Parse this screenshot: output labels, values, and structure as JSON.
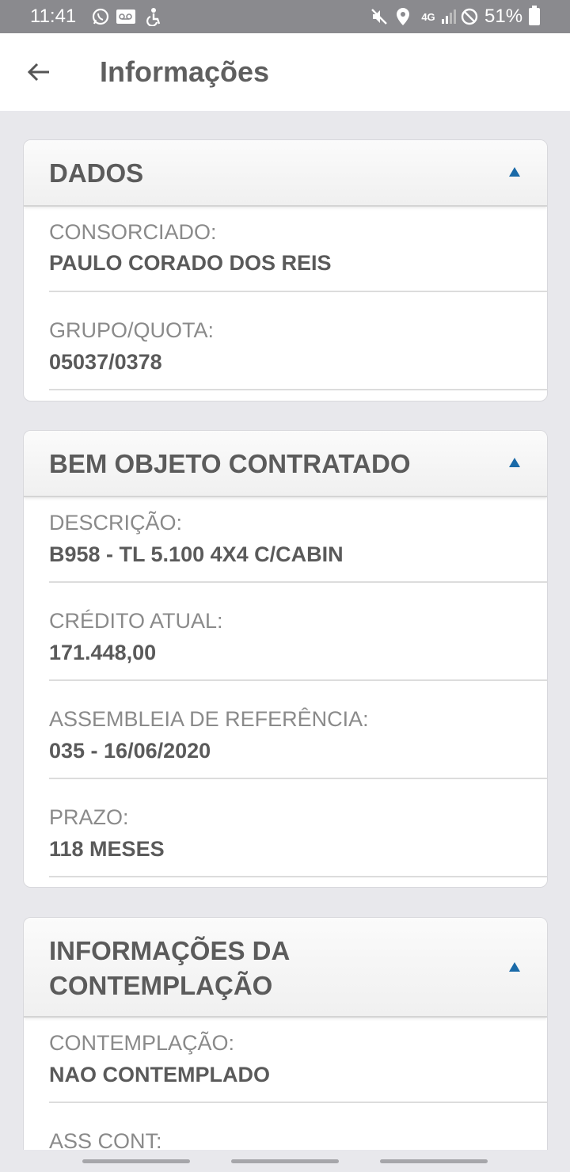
{
  "status_bar": {
    "time": "11:41",
    "battery": "51%",
    "network": "4G",
    "icons": [
      "whatsapp-icon",
      "voicemail-icon",
      "accessibility-icon",
      "mute-icon",
      "location-icon",
      "signal-icon",
      "do-not-disturb-icon",
      "battery-icon"
    ]
  },
  "app_bar": {
    "title": "Informações",
    "back_icon": "arrow-left-icon"
  },
  "sections": {
    "dados": {
      "title": "DADOS",
      "fields": [
        {
          "label": "CONSORCIADO:",
          "value": "PAULO CORADO DOS REIS"
        },
        {
          "label": "GRUPO/QUOTA:",
          "value": "05037/0378"
        }
      ]
    },
    "bem": {
      "title": "BEM OBJETO CONTRATADO",
      "fields": [
        {
          "label": "DESCRIÇÃO:",
          "value": "B958 - TL 5.100 4X4 C/CABIN"
        },
        {
          "label": "CRÉDITO ATUAL:",
          "value": "171.448,00"
        },
        {
          "label": "ASSEMBLEIA DE REFERÊNCIA:",
          "value": "035 - 16/06/2020"
        },
        {
          "label": "PRAZO:",
          "value": "118 MESES"
        }
      ]
    },
    "contemplacao": {
      "title_line1": "INFORMAÇÕES DA",
      "title_line2": "CONTEMPLAÇÃO",
      "fields": [
        {
          "label": "CONTEMPLAÇÃO:",
          "value": "NAO CONTEMPLADO"
        },
        {
          "label": "ASS CONT:"
        }
      ]
    }
  },
  "colors": {
    "accent": "#1a6aa8",
    "status_bar": "#8a8a8e",
    "background": "#e8e8ec"
  }
}
